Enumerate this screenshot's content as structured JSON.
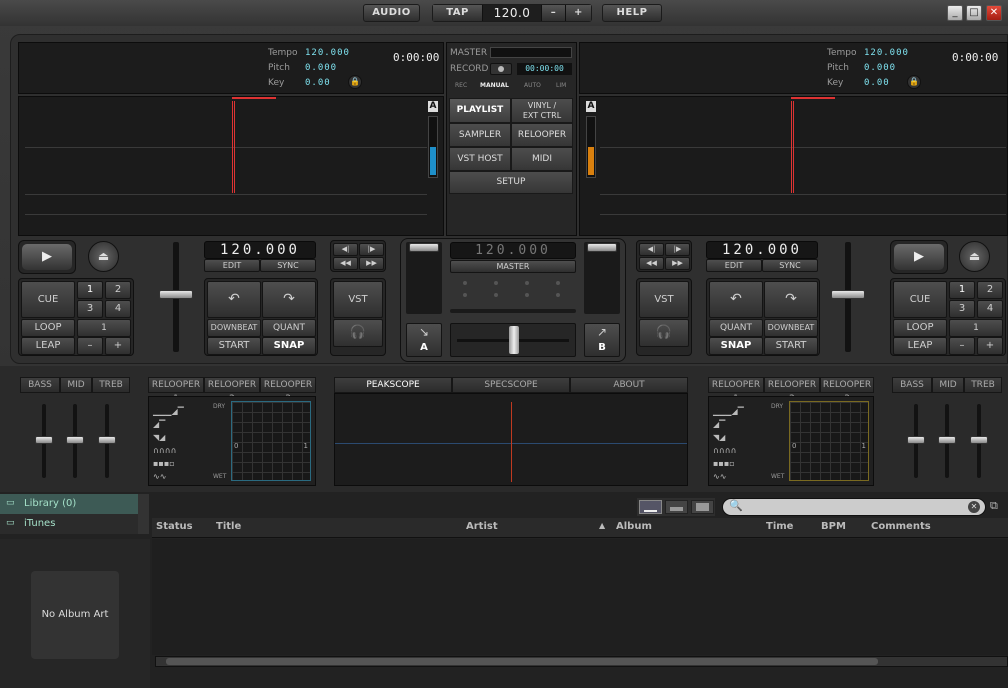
{
  "topbar": {
    "audio": "AUDIO",
    "tap": "TAP",
    "bpm": "120.0",
    "minus": "–",
    "plus": "+",
    "help": "HELP",
    "win_min": "_",
    "win_max": "□",
    "win_close": "✕"
  },
  "deck_left": {
    "tempo_label": "Tempo",
    "tempo": "120.000",
    "pitch_label": "Pitch",
    "pitch": "0.000",
    "key_label": "Key",
    "key": "0.00",
    "time": "0:00:00",
    "deck_letter": "A",
    "bpm_display": "120.000",
    "edit": "EDIT",
    "sync": "SYNC",
    "cue": "CUE",
    "loop": "LOOP",
    "leap": "LEAP",
    "n1": "1",
    "n2": "2",
    "n3": "3",
    "n4": "4",
    "loop_len": "1",
    "minus": "–",
    "plus": "+",
    "downbeat": "DOWNBEAT",
    "quant": "QUANT",
    "start": "START",
    "snap": "SNAP",
    "vst": "VST",
    "level_color": "#1e8fc9"
  },
  "deck_right": {
    "tempo_label": "Tempo",
    "tempo": "120.000",
    "pitch_label": "Pitch",
    "pitch": "0.000",
    "key_label": "Key",
    "key": "0.00",
    "time": "0:00:00",
    "deck_letter": "A",
    "bpm_display": "120.000",
    "edit": "EDIT",
    "sync": "SYNC",
    "cue": "CUE",
    "loop": "LOOP",
    "leap": "LEAP",
    "n1": "1",
    "n2": "2",
    "n3": "3",
    "n4": "4",
    "loop_len": "1",
    "minus": "–",
    "plus": "+",
    "downbeat": "DOWNBEAT",
    "quant": "QUANT",
    "start": "START",
    "snap": "SNAP",
    "vst": "VST",
    "level_color": "#d9800e"
  },
  "center": {
    "master_label": "MASTER",
    "record_label": "RECORD",
    "rec_time": "00:00:00",
    "mode_rec": "REC",
    "mode_manual": "MANUAL",
    "mode_auto": "AUTO",
    "mode_lim": "LIM",
    "playlist": "PLAYLIST",
    "vinyl1": "VINYL /",
    "vinyl2": "EXT CTRL",
    "sampler": "SAMPLER",
    "relooper": "RELOOPER",
    "vst_host": "VST HOST",
    "midi": "MIDI",
    "setup": "SETUP",
    "master_bpm": "120.000",
    "master": "MASTER",
    "xfade_a": "A",
    "xfade_b": "B"
  },
  "effects": {
    "bass": "BASS",
    "mid": "MID",
    "treb": "TREB",
    "relooper1": "RELOOPER 1",
    "relooper2": "RELOOPER 2",
    "relooper3": "RELOOPER 3",
    "dry": "DRY",
    "wet": "WET",
    "zero": "0",
    "one": "1",
    "peakscope": "PEAKSCOPE",
    "specscope": "SPECSCOPE",
    "about": "ABOUT"
  },
  "library": {
    "library_item": "Library (0)",
    "itunes_item": "iTunes",
    "no_album_art": "No Album Art",
    "search_placeholder": "",
    "columns": [
      "Status",
      "Title",
      "Artist",
      "Album",
      "Time",
      "BPM",
      "Comments"
    ]
  }
}
